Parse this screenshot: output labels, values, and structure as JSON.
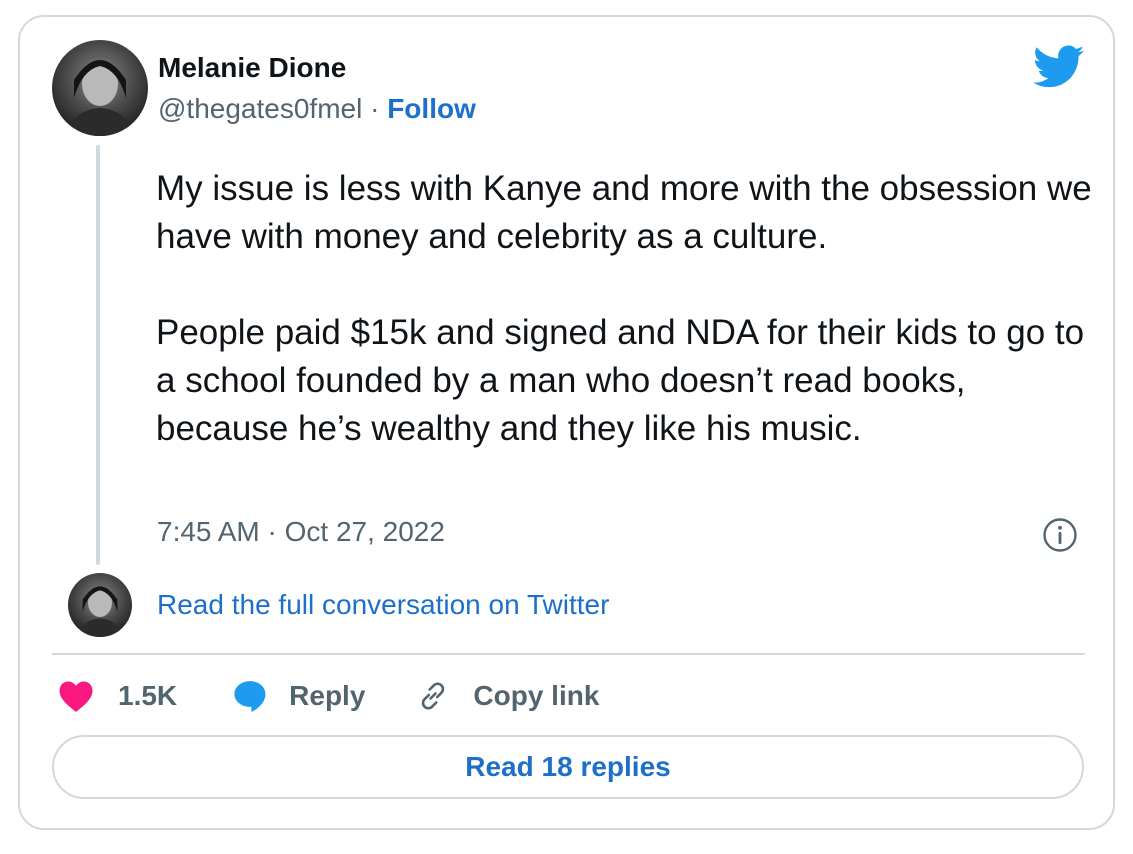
{
  "author": {
    "name": "Melanie Dione",
    "handle": "@thegates0fmel",
    "separator": "·",
    "follow_label": "Follow"
  },
  "tweet": {
    "paragraphs": [
      "My issue is less with Kanye and more with the obsession we have with money and celebrity as a culture.",
      "People paid $15k and signed and NDA for their kids to go to a school founded by a man who doesn’t read books, because he’s wealthy and they like his music."
    ],
    "timestamp": "7:45 AM · Oct 27, 2022"
  },
  "conversation_link": "Read the full conversation on Twitter",
  "actions": {
    "like_count": "1.5K",
    "reply_label": "Reply",
    "copy_link_label": "Copy link"
  },
  "read_replies_label": "Read 18 replies",
  "colors": {
    "link_blue": "#1d70c9",
    "twitter_blue": "#1d9bf0",
    "like_pink": "#f91880",
    "muted_gray": "#536471",
    "border": "#cfd9de"
  },
  "icons": {
    "brand": "twitter-bird-icon",
    "info": "info-icon",
    "like": "heart-icon",
    "reply": "speech-bubble-icon",
    "copy_link": "link-icon"
  }
}
